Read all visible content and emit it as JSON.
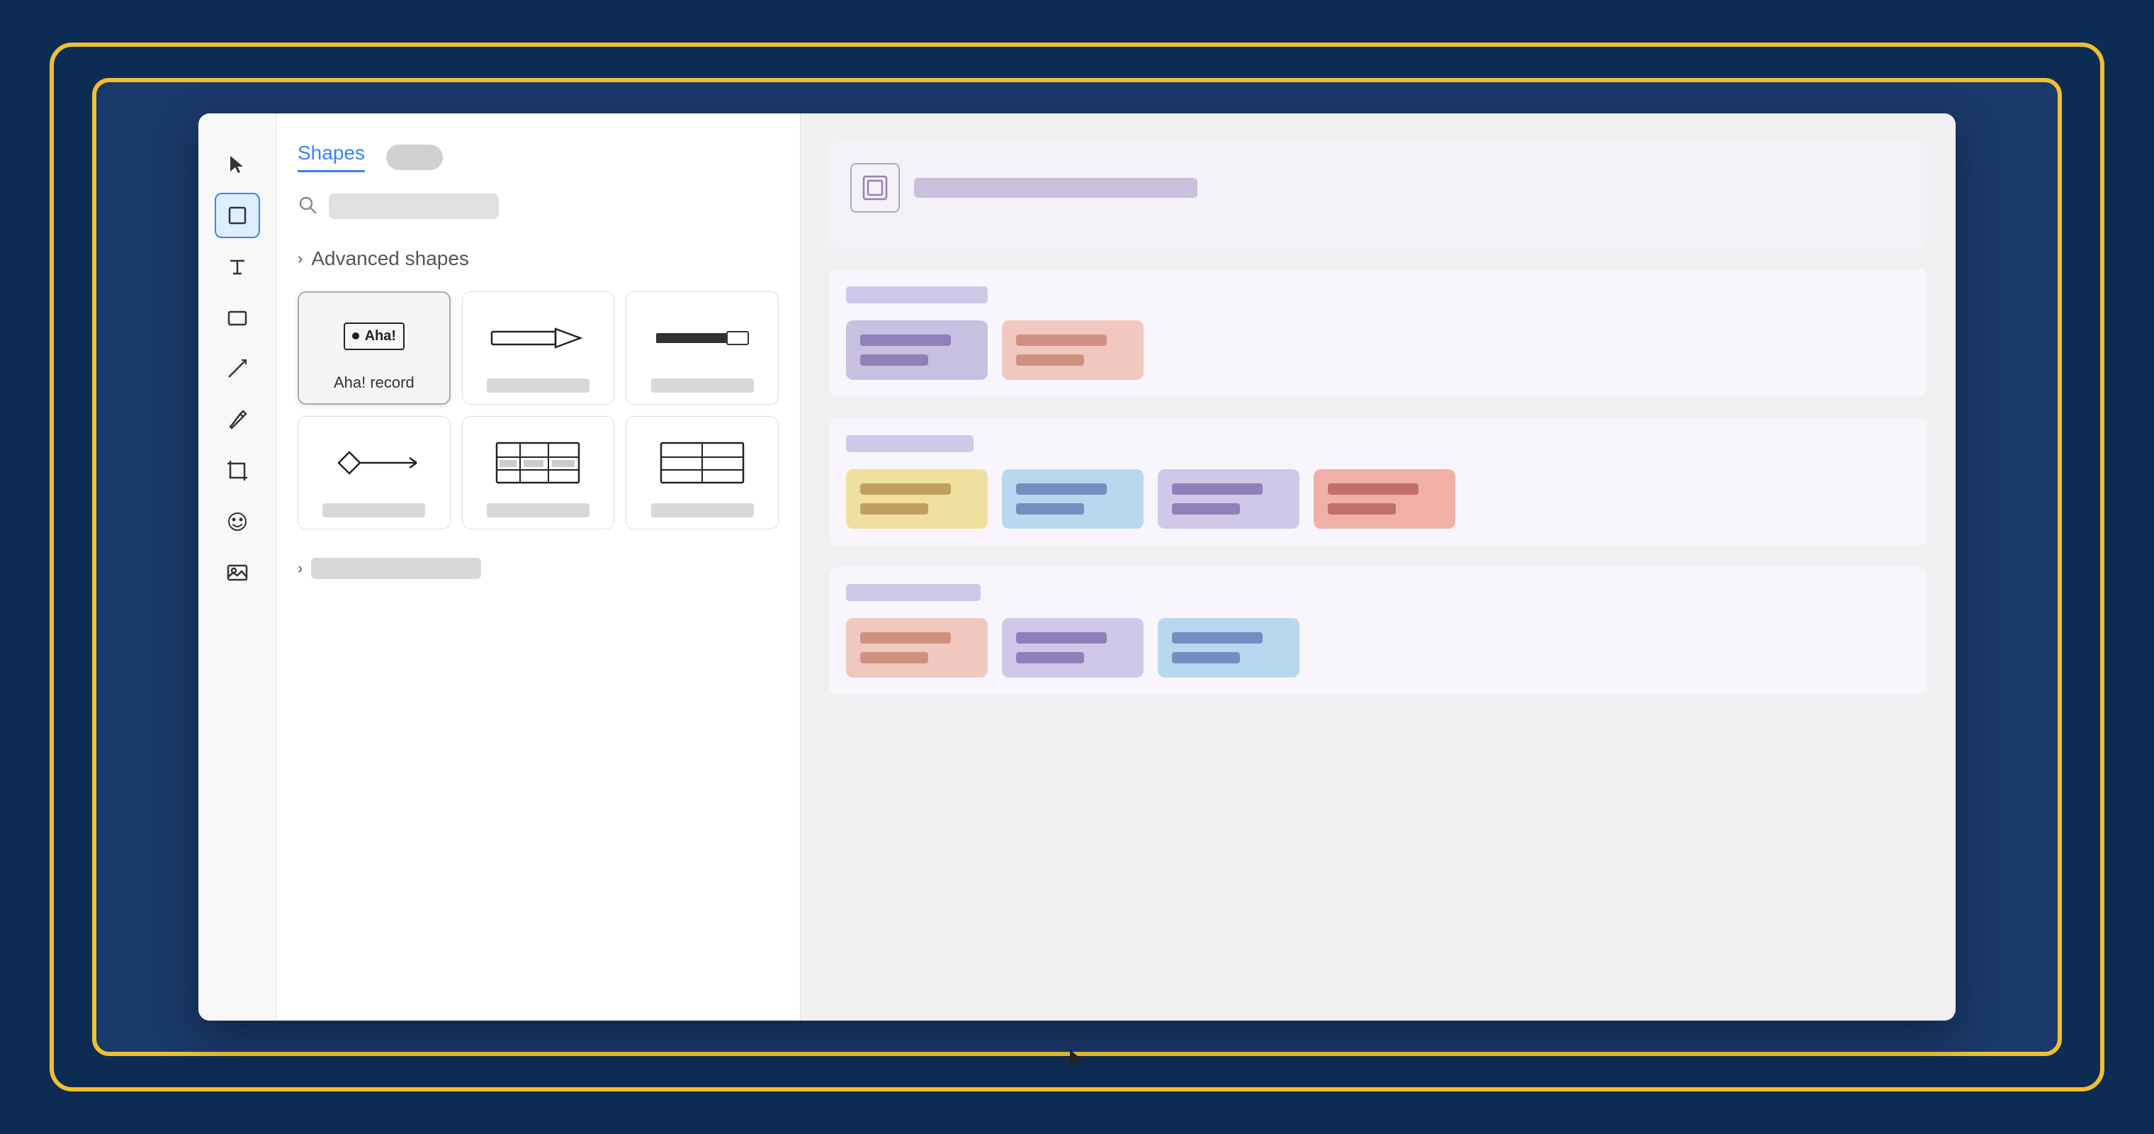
{
  "background": {
    "outer_border_color": "#f0c030",
    "inner_bg_color": "#1a3a6b"
  },
  "toolbar": {
    "buttons": [
      {
        "name": "select-tool",
        "icon": "cursor",
        "active": false
      },
      {
        "name": "frame-tool",
        "icon": "square",
        "active": true
      },
      {
        "name": "text-tool",
        "icon": "text",
        "active": false
      },
      {
        "name": "shape-tool",
        "icon": "rectangle",
        "active": false
      },
      {
        "name": "line-tool",
        "icon": "diagonal-line",
        "active": false
      },
      {
        "name": "pen-tool",
        "icon": "pen",
        "active": false
      },
      {
        "name": "crop-tool",
        "icon": "crop",
        "active": false
      },
      {
        "name": "emoji-tool",
        "icon": "emoji",
        "active": false
      },
      {
        "name": "image-tool",
        "icon": "image",
        "active": false
      }
    ]
  },
  "shapes_panel": {
    "tab_label": "Shapes",
    "search_placeholder": "",
    "section_title": "Advanced shapes",
    "shapes": [
      {
        "id": "aha-record",
        "label": "Aha! record",
        "icon_type": "aha-record",
        "selected": true
      },
      {
        "id": "shape-2",
        "label": "",
        "icon_type": "arrow-connector",
        "selected": false
      },
      {
        "id": "shape-3",
        "label": "",
        "icon_type": "line-connector",
        "selected": false
      },
      {
        "id": "shape-4",
        "label": "",
        "icon_type": "diamond-line",
        "selected": false
      },
      {
        "id": "shape-5",
        "label": "",
        "icon_type": "table-detailed",
        "selected": false
      },
      {
        "id": "shape-6",
        "label": "",
        "icon_type": "table-simple",
        "selected": false
      }
    ],
    "more_label": ""
  },
  "canvas": {
    "sections": [
      {
        "id": "frame-section",
        "type": "frame",
        "header_placeholder_width": 400
      },
      {
        "id": "group-1",
        "group_label_width": 200,
        "cards": [
          {
            "color": "purple"
          },
          {
            "color": "pink"
          }
        ]
      },
      {
        "id": "group-2",
        "group_label_width": 180,
        "cards": [
          {
            "color": "yellow"
          },
          {
            "color": "blue"
          },
          {
            "color": "lavender"
          },
          {
            "color": "salmon"
          }
        ]
      },
      {
        "id": "group-3",
        "group_label_width": 190,
        "cards": [
          {
            "color": "pink"
          },
          {
            "color": "lavender"
          },
          {
            "color": "blue"
          }
        ]
      }
    ]
  }
}
